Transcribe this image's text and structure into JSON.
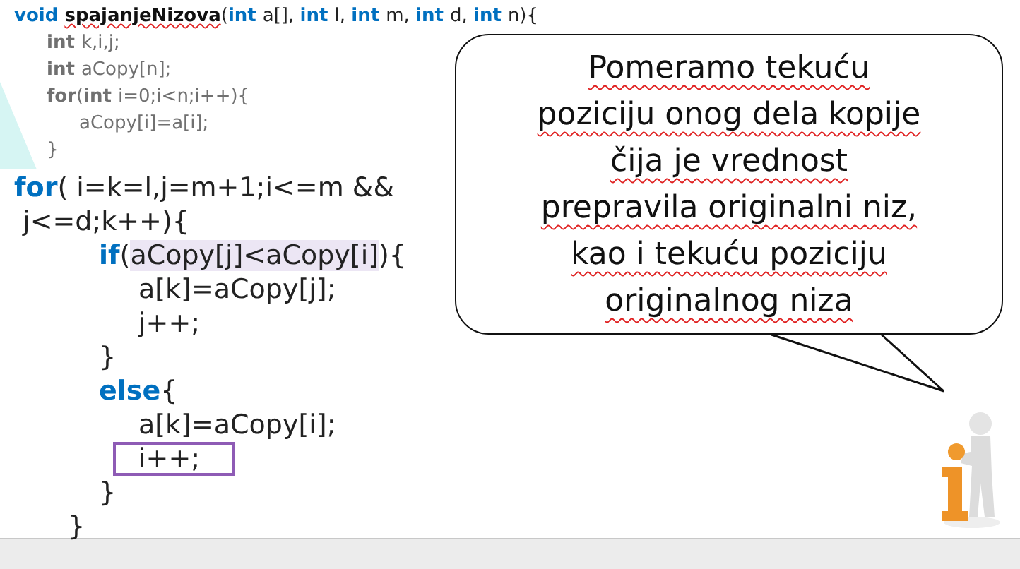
{
  "setup_code": {
    "header": {
      "tokens": [
        {
          "text": "void ",
          "kind": "keyword"
        },
        {
          "text": "spajanjeNizova",
          "kind": "name"
        },
        {
          "text": "(",
          "kind": "text"
        },
        {
          "text": "int ",
          "kind": "keyword"
        },
        {
          "text": "a[], ",
          "kind": "text"
        },
        {
          "text": "int ",
          "kind": "keyword"
        },
        {
          "text": "l, ",
          "kind": "text"
        },
        {
          "text": "int ",
          "kind": "keyword"
        },
        {
          "text": "m, ",
          "kind": "text"
        },
        {
          "text": "int ",
          "kind": "keyword"
        },
        {
          "text": "d, ",
          "kind": "text"
        },
        {
          "text": "int ",
          "kind": "keyword"
        },
        {
          "text": "n){",
          "kind": "text"
        }
      ]
    },
    "children": [
      {
        "tokens": [
          {
            "text": "int ",
            "kind": "muted_keyword"
          },
          {
            "text": "k,i,j;",
            "kind": "muted_text"
          }
        ]
      },
      {
        "tokens": [
          {
            "text": "int ",
            "kind": "muted_keyword"
          },
          {
            "text": "aCopy[n];",
            "kind": "muted_text"
          }
        ]
      },
      {
        "tokens": [
          {
            "text": "for",
            "kind": "muted_keyword"
          },
          {
            "text": "(",
            "kind": "muted_text"
          },
          {
            "text": "int ",
            "kind": "muted_keyword"
          },
          {
            "text": "i=0;i<n;i++){",
            "kind": "muted_text"
          }
        ],
        "children": [
          {
            "tokens": [
              {
                "text": "aCopy[i]=a[i];",
                "kind": "muted_text"
              }
            ]
          }
        ]
      },
      {
        "tokens": [
          {
            "text": "}",
            "kind": "muted_text"
          }
        ]
      }
    ]
  },
  "loop_code": {
    "header": [
      {
        "tokens": [
          {
            "text": "for",
            "kind": "keyword"
          },
          {
            "text": "( i=k=l,j=m+1;i<=m &&",
            "kind": "text"
          }
        ]
      },
      {
        "tokens": [
          {
            "text": " j<=d;k++){",
            "kind": "text"
          }
        ]
      }
    ],
    "children": [
      {
        "tokens": [
          {
            "text": "if",
            "kind": "keyword"
          },
          {
            "text": "(",
            "kind": "text"
          },
          {
            "text": "aCopy[j]<aCopy[i]",
            "kind": "text",
            "highlighted": true
          },
          {
            "text": "){",
            "kind": "text"
          }
        ],
        "children": [
          {
            "tokens": [
              {
                "text": "a[k]=aCopy[j];",
                "kind": "text"
              }
            ]
          },
          {
            "tokens": [
              {
                "text": "j++;",
                "kind": "text"
              }
            ]
          }
        ]
      },
      {
        "tokens": [
          {
            "text": "}",
            "kind": "text"
          }
        ]
      },
      {
        "tokens": [
          {
            "text": "else",
            "kind": "keyword"
          },
          {
            "text": "{",
            "kind": "text"
          }
        ],
        "children": [
          {
            "tokens": [
              {
                "text": "a[k]=aCopy[i];",
                "kind": "text"
              }
            ]
          },
          {
            "tokens": [
              {
                "text": "i++;",
                "kind": "text"
              }
            ],
            "boxed": true
          }
        ]
      },
      {
        "tokens": [
          {
            "text": "}",
            "kind": "text"
          }
        ]
      }
    ],
    "closing": {
      "tokens": [
        {
          "text": "}",
          "kind": "text"
        }
      ]
    }
  },
  "speech_bubble": {
    "lines": [
      "Pomeramo tekuću",
      "poziciju onog dela kopije",
      "čija je vrednost",
      "prepravila originalni niz,",
      "kao i tekuću poziciju",
      "originalnog niza"
    ]
  }
}
